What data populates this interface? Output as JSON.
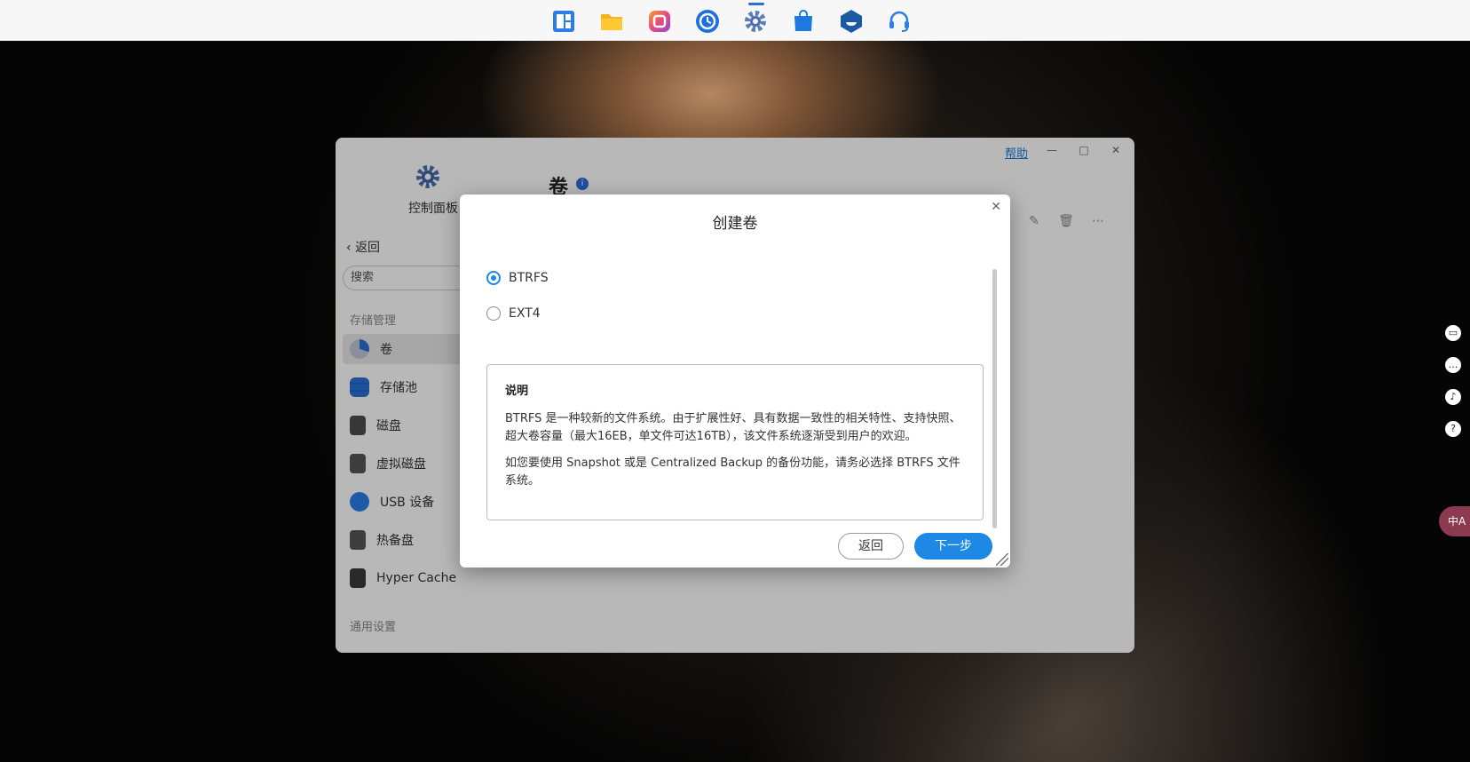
{
  "dock": {
    "items": [
      {
        "name": "app-center",
        "color": "#2b7de9"
      },
      {
        "name": "file-manager",
        "color": "#f5b41e"
      },
      {
        "name": "photos",
        "color": "#e94a7a"
      },
      {
        "name": "backup",
        "color": "#1e6fe0"
      },
      {
        "name": "control-panel",
        "color": "#4a6fb0"
      },
      {
        "name": "store",
        "color": "#1e7ae0"
      },
      {
        "name": "docker",
        "color": "#1d5aa6"
      },
      {
        "name": "support",
        "color": "#2b7de9"
      }
    ]
  },
  "window": {
    "help": "帮助",
    "app_title": "控制面板",
    "back": "返回",
    "search_placeholder": "搜索",
    "storage_section": "存储管理",
    "general_section": "通用设置",
    "sidebar_items": [
      {
        "label": "卷",
        "icon": "volume-icon"
      },
      {
        "label": "存储池",
        "icon": "storage-pool-icon"
      },
      {
        "label": "磁盘",
        "icon": "disk-icon"
      },
      {
        "label": "虚拟磁盘",
        "icon": "virtual-disk-icon"
      },
      {
        "label": "USB 设备",
        "icon": "usb-icon"
      },
      {
        "label": "热备盘",
        "icon": "hot-spare-icon"
      },
      {
        "label": "Hyper Cache",
        "icon": "hyper-cache-icon"
      }
    ],
    "content_title": "卷"
  },
  "modal": {
    "title": "创建卷",
    "options": [
      {
        "label": "BTRFS",
        "checked": true
      },
      {
        "label": "EXT4",
        "checked": false
      }
    ],
    "desc_heading": "说明",
    "desc_p1": "BTRFS 是一种较新的文件系统。由于扩展性好、具有数据一致性的相关特性、支持快照、超大卷容量（最大16EB，单文件可达16TB），该文件系统逐渐受到用户的欢迎。",
    "desc_p2": "如您要使用 Snapshot 或是 Centralized Backup 的备份功能，请务必选择 BTRFS 文件系统。",
    "back_button": "返回",
    "next_button": "下一步"
  },
  "right_rail": {
    "translate_label": "中A"
  }
}
